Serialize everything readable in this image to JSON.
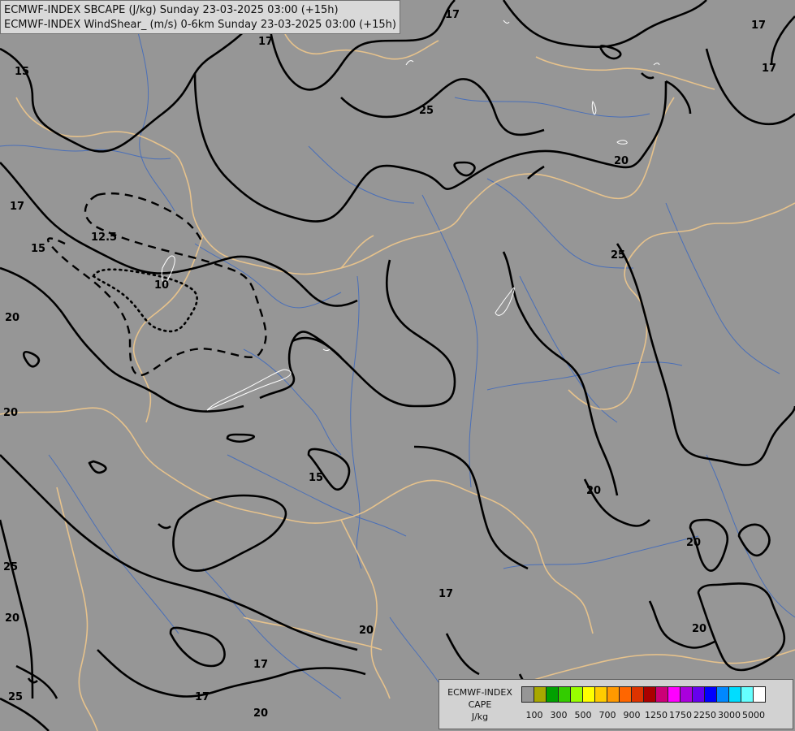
{
  "title": {
    "line1": "ECMWF-INDEX SBCAPE (J/kg) Sunday 23-03-2025 03:00 (+15h)",
    "line2": "ECMWF-INDEX WindShear_ (m/s) 0-6km Sunday 23-03-2025 03:00 (+15h)"
  },
  "colors": {
    "background": "#969696",
    "border_lines": "#e6c28c",
    "rivers": "#4a6fb8",
    "contours": "#000000",
    "cape_outline": "#ffffff"
  },
  "legend": {
    "line1": "ECMWF-INDEX",
    "line2": "CAPE",
    "line3": "J/kg",
    "swatches": [
      "#969696",
      "#a8a800",
      "#00a000",
      "#33cc00",
      "#99ff00",
      "#ffff00",
      "#ffcc00",
      "#ff9900",
      "#ff6600",
      "#dd3300",
      "#aa0000",
      "#cc0077",
      "#ff00ff",
      "#aa00dd",
      "#6600ee",
      "#0000ff",
      "#0088ff",
      "#00ddff",
      "#66ffff",
      "#ffffff"
    ],
    "ticks": [
      "100",
      "300",
      "500",
      "700",
      "900",
      "1250",
      "1750",
      "2250",
      "3000",
      "5000"
    ]
  },
  "contour_labels": [
    "17",
    "17",
    "17",
    "17",
    "17",
    "17",
    "17",
    "17",
    "15",
    "15",
    "15",
    "20",
    "20",
    "20",
    "20",
    "20",
    "20",
    "20",
    "20",
    "20",
    "25",
    "25",
    "25",
    "25",
    "12.5",
    "10"
  ]
}
